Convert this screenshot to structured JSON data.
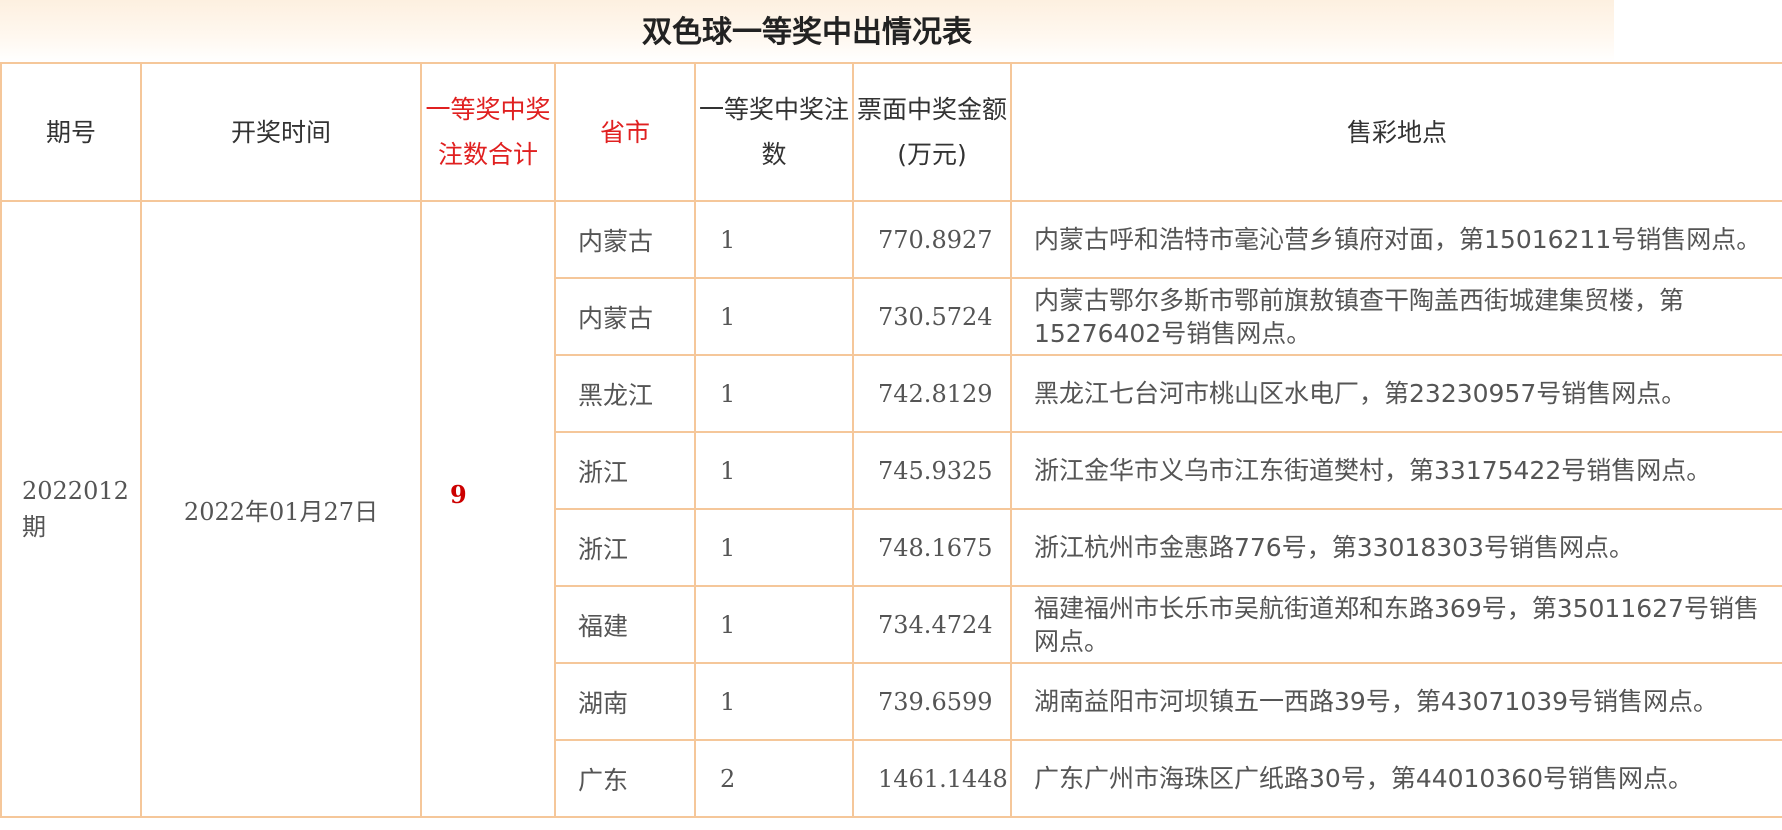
{
  "title": "双色球一等奖中出情况表",
  "columns": {
    "issue": "期号",
    "date": "开奖时间",
    "total": "一等奖中奖注数合计",
    "province": "省市",
    "count": "一等奖中奖注数",
    "amount": "票面中奖金额",
    "amount_unit": "(万元)",
    "location": "售彩地点"
  },
  "colors": {
    "border": "#f5c79a",
    "header_red": "#e02020",
    "total_red": "#cc0000"
  },
  "record": {
    "issue": "2022012期",
    "date": "2022年01月27日",
    "total": "9"
  },
  "rows": [
    {
      "province": "内蒙古",
      "count": "1",
      "amount": "770.8927",
      "location": "内蒙古呼和浩特市毫沁营乡镇府对面，第15016211号销售网点。"
    },
    {
      "province": "内蒙古",
      "count": "1",
      "amount": "730.5724",
      "location": "内蒙古鄂尔多斯市鄂前旗敖镇查干陶盖西街城建集贸楼，第15276402号销售网点。"
    },
    {
      "province": "黑龙江",
      "count": "1",
      "amount": "742.8129",
      "location": "黑龙江七台河市桃山区水电厂，第23230957号销售网点。"
    },
    {
      "province": "浙江",
      "count": "1",
      "amount": "745.9325",
      "location": "浙江金华市义乌市江东街道樊村，第33175422号销售网点。"
    },
    {
      "province": "浙江",
      "count": "1",
      "amount": "748.1675",
      "location": "浙江杭州市金惠路776号，第33018303号销售网点。"
    },
    {
      "province": "福建",
      "count": "1",
      "amount": "734.4724",
      "location": "福建福州市长乐市吴航街道郑和东路369号，第35011627号销售网点。"
    },
    {
      "province": "湖南",
      "count": "1",
      "amount": "739.6599",
      "location": "湖南益阳市河坝镇五一西路39号，第43071039号销售网点。"
    },
    {
      "province": "广东",
      "count": "2",
      "amount": "1461.1448",
      "location": "广东广州市海珠区广纸路30号，第44010360号销售网点。"
    }
  ]
}
